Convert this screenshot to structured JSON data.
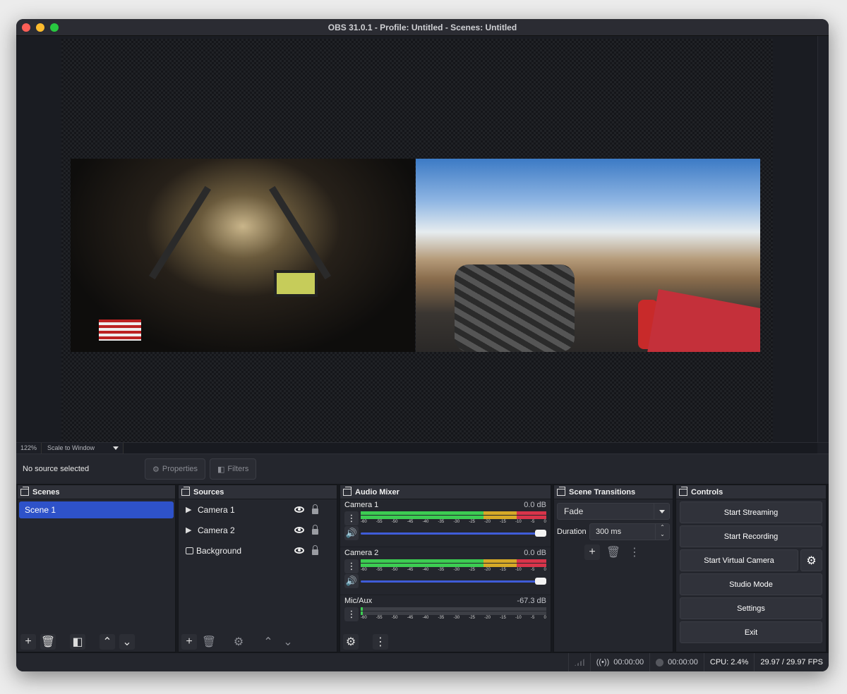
{
  "window": {
    "title": "OBS 31.0.1 - Profile: Untitled - Scenes: Untitled"
  },
  "preview": {
    "zoom": "122%",
    "scale_mode": "Scale to Window"
  },
  "context_bar": {
    "no_source": "No source selected",
    "properties_label": "Properties",
    "filters_label": "Filters"
  },
  "scenes": {
    "title": "Scenes",
    "items": [
      {
        "label": "Scene 1",
        "selected": true
      }
    ]
  },
  "sources": {
    "title": "Sources",
    "items": [
      {
        "label": "Camera 1",
        "icon": "play-icon"
      },
      {
        "label": "Camera 2",
        "icon": "play-icon"
      },
      {
        "label": "Background",
        "icon": "image-icon"
      }
    ]
  },
  "audio_mixer": {
    "title": "Audio Mixer",
    "ticks": [
      "-60",
      "-55",
      "-50",
      "-45",
      "-40",
      "-35",
      "-30",
      "-25",
      "-20",
      "-15",
      "-10",
      "-5",
      "0"
    ],
    "channels": [
      {
        "name": "Camera 1",
        "db": "0.0 dB",
        "level": 1.0
      },
      {
        "name": "Camera 2",
        "db": "0.0 dB",
        "level": 1.0
      },
      {
        "name": "Mic/Aux",
        "db": "-67.3 dB",
        "level": 0.0
      }
    ]
  },
  "scene_transitions": {
    "title": "Scene Transitions",
    "transition": "Fade",
    "duration_label": "Duration",
    "duration_value": "300 ms"
  },
  "controls": {
    "title": "Controls",
    "start_streaming": "Start Streaming",
    "start_recording": "Start Recording",
    "start_virtual_camera": "Start Virtual Camera",
    "studio_mode": "Studio Mode",
    "settings": "Settings",
    "exit": "Exit"
  },
  "status": {
    "stream_time": "00:00:00",
    "record_time": "00:00:00",
    "cpu": "CPU: 2.4%",
    "fps": "29.97 / 29.97 FPS"
  },
  "colors": {
    "accent": "#2e52c9",
    "meter_green": "#3ccc52",
    "meter_yellow": "#d6a927",
    "meter_red": "#d8344a",
    "volume": "#3f5cd8"
  }
}
